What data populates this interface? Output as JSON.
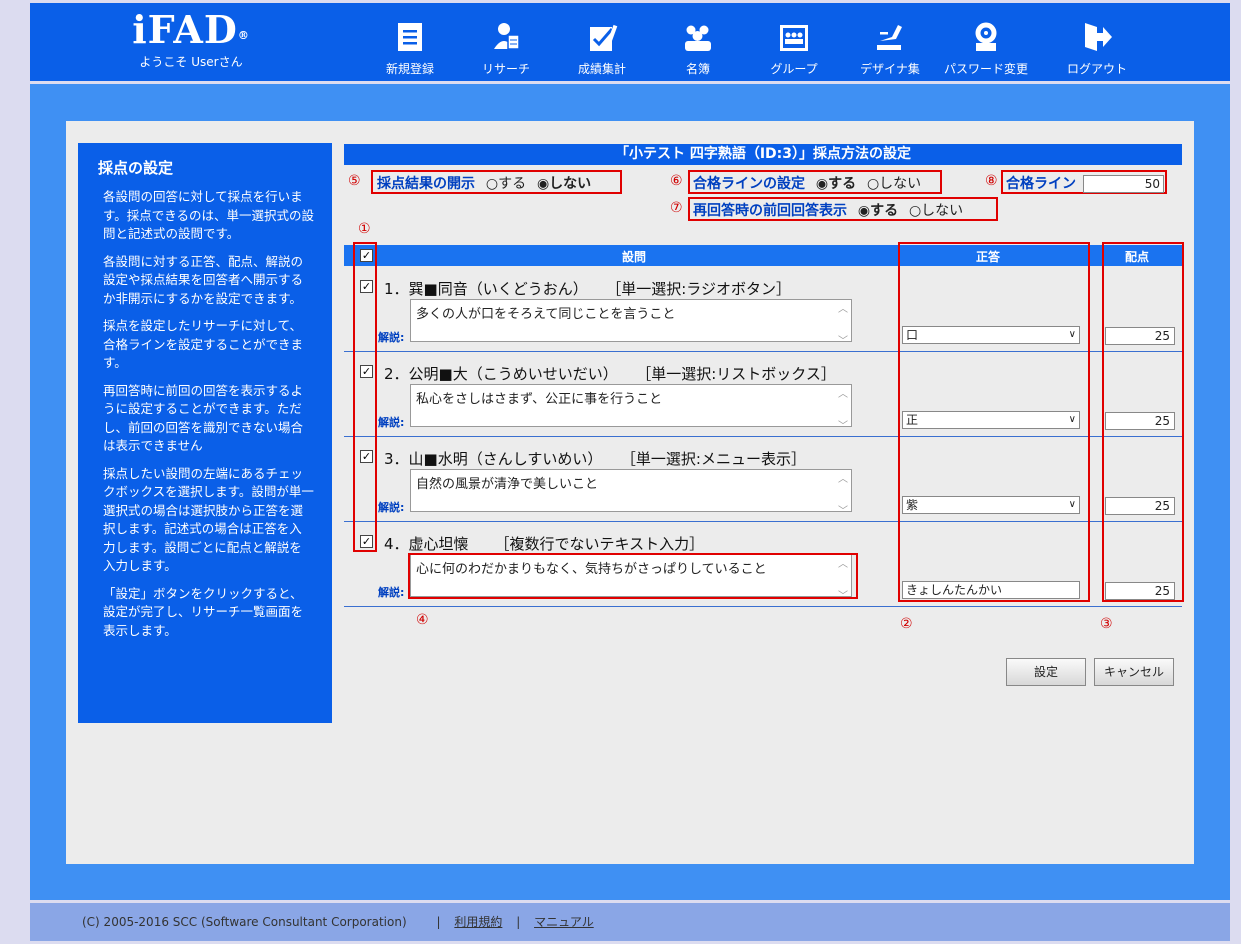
{
  "header": {
    "brand": "iFAD",
    "registered_mark": "®",
    "welcome": "ようこそ Userさん",
    "nav": [
      {
        "label": "新規登録",
        "icon": "document-icon"
      },
      {
        "label": "リサーチ",
        "icon": "research-icon"
      },
      {
        "label": "成績集計",
        "icon": "grades-icon"
      },
      {
        "label": "名簿",
        "icon": "roster-icon"
      },
      {
        "label": "グループ",
        "icon": "group-icon"
      },
      {
        "label": "デザイナ集",
        "icon": "designer-icon"
      },
      {
        "label": "パスワード変更",
        "icon": "password-icon"
      },
      {
        "label": "ログアウト",
        "icon": "logout-icon"
      }
    ]
  },
  "help": {
    "title": "採点の設定",
    "paragraphs": [
      "各設問の回答に対して採点を行います。採点できるのは、単一選択式の設問と記述式の設問です。",
      "各設問に対する正答、配点、解説の設定や採点結果を回答者へ開示するか非開示にするかを設定できます。",
      "採点を設定したリサーチに対して、合格ラインを設定することができます。",
      "再回答時に前回の回答を表示するように設定することができます。ただし、前回の回答を識別できない場合は表示できません",
      "採点したい設問の左端にあるチェックボックスを選択します。設問が単一選択式の場合は選択肢から正答を選択します。記述式の場合は正答を入力します。設問ごとに配点と解説を入力します。",
      "「設定」ボタンをクリックすると、設定が完了し、リサーチ一覧画面を表示します。"
    ]
  },
  "form": {
    "title": "「小テスト 四字熟語（ID:3）」採点方法の設定",
    "disclose": {
      "num": "⑤",
      "label": "採点結果の開示",
      "yes": "○する",
      "no": "◉しない"
    },
    "passline_setting": {
      "num": "⑥",
      "label": "合格ラインの設定",
      "yes": "◉する",
      "no": "○しない"
    },
    "prev_answer": {
      "num": "⑦",
      "label": "再回答時の前回回答表示",
      "yes": "◉する",
      "no": "○しない"
    },
    "passline": {
      "num": "⑧",
      "label": "合格ライン",
      "value": "50"
    },
    "table_header": {
      "question": "設問",
      "answer": "正答",
      "score": "配点"
    },
    "annotations": {
      "checkbox_col": "①",
      "answer_col": "②",
      "score_col": "③",
      "explanation": "④"
    },
    "explanation_label": "解説:",
    "check_mark": "✓",
    "rows": [
      {
        "title": "1．巽■同音（いくどうおん）",
        "type": "［単一選択:ラジオボタン］",
        "explanation": "多くの人が口をそろえて同じことを言うこと",
        "answer": "口",
        "score": "25"
      },
      {
        "title": "2．公明■大（こうめいせいだい）",
        "type": "［単一選択:リストボックス］",
        "explanation": "私心をさしはさまず、公正に事を行うこと",
        "answer": "正",
        "score": "25"
      },
      {
        "title": "3．山■水明（さんしすいめい）",
        "type": "［単一選択:メニュー表示］",
        "explanation": "自然の風景が清浄で美しいこと",
        "answer": "紫",
        "score": "25"
      },
      {
        "title": "4．虚心坦懐",
        "type": "［複数行でないテキスト入力］",
        "explanation": "心に何のわだかまりもなく、気持ちがさっぱりしていること",
        "answer": "きょしんたんかい",
        "score": "25"
      }
    ],
    "buttons": {
      "save": "設定",
      "cancel": "キャンセル"
    }
  },
  "footer": {
    "copyright": "(C) 2005-2016 SCC (Software Consultant Corporation)",
    "separator": "|",
    "terms": "利用規約",
    "manual": "マニュアル"
  }
}
